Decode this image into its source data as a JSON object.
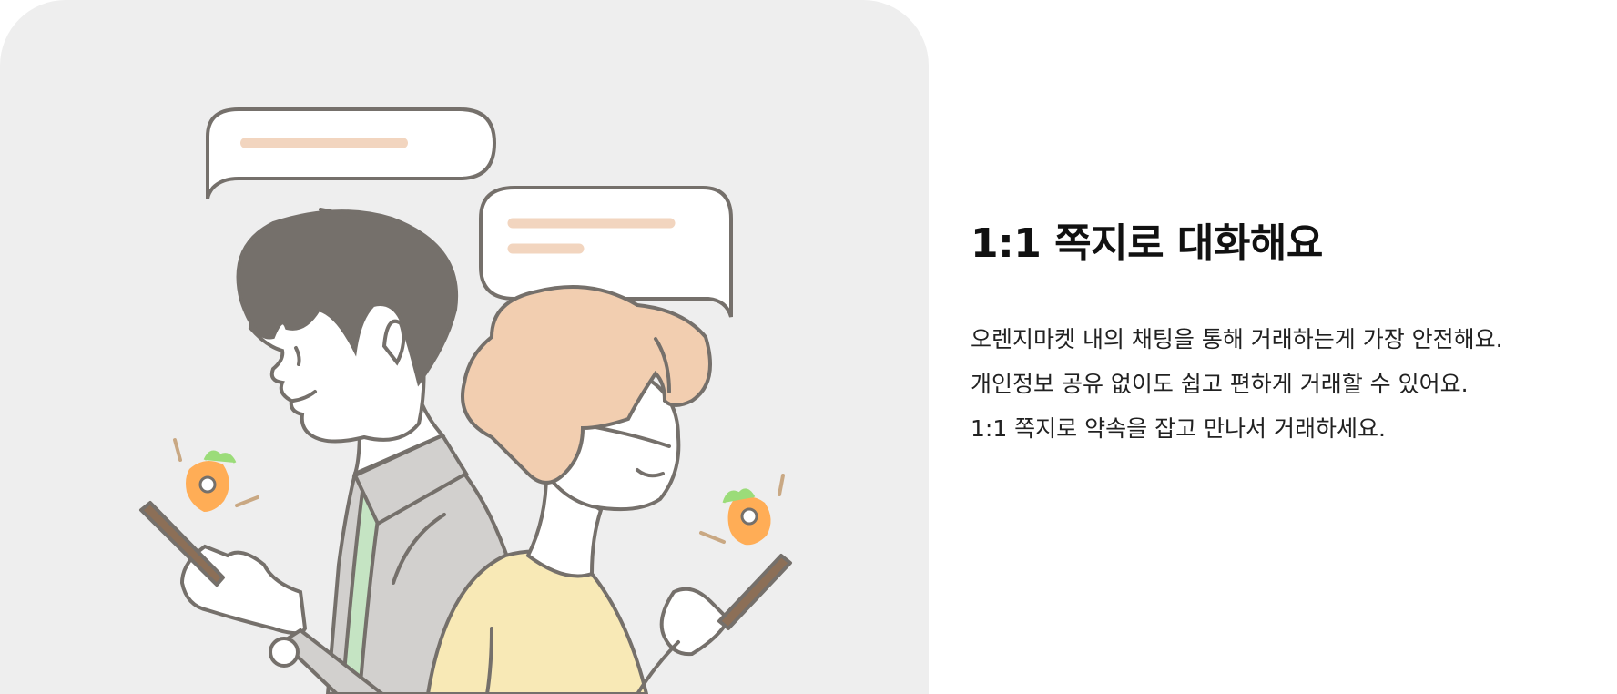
{
  "section": {
    "title": "1:1 쪽지로 대화해요",
    "description_lines": [
      "오렌지마켓 내의 채팅을 통해 거래하는게 가장 안전해요.",
      "개인정보 공유 없이도 쉽고 편하게 거래할 수 있어요.",
      "1:1 쪽지로 약속을 잡고 만나서 거래하세요."
    ]
  },
  "illustration": {
    "background_color": "#eeeeee",
    "outline_color": "#75706b",
    "hair_man_color": "#75706b",
    "hair_woman_color": "#f2ceb0",
    "shirt_woman_color": "#f8e9b6",
    "jacket_man_color": "#d2d0ce",
    "inner_shirt_color": "#c5e4c3",
    "carrot_color": "#ffad56",
    "leaf_color": "#9bdc79",
    "message_line_color": "#f2d5bf",
    "phone_color": "#8c6f57"
  }
}
